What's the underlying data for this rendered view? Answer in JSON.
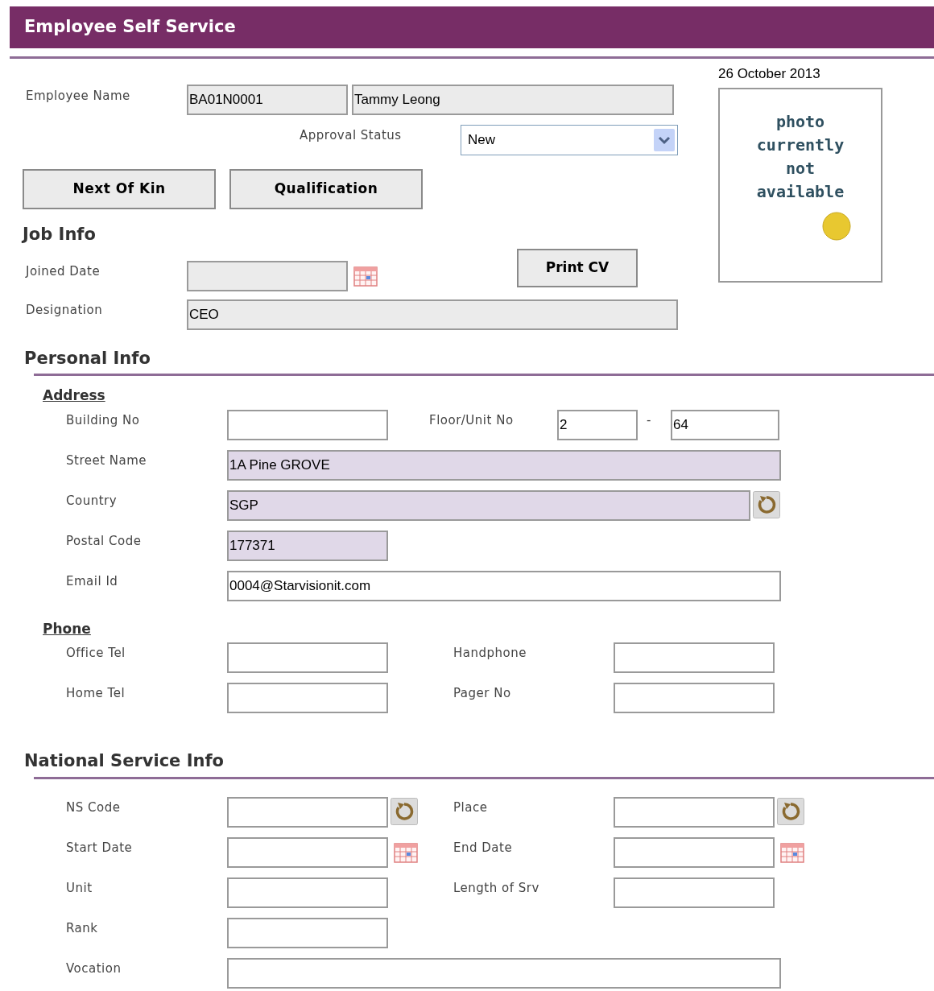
{
  "header": {
    "title": "Employee Self Service"
  },
  "date": "26 October 2013",
  "photo": {
    "text": "photo currently not available"
  },
  "employee": {
    "label": "Employee Name",
    "code": {
      "value": "BA01N0001",
      "disabled": true
    },
    "name": {
      "value": "Tammy Leong",
      "disabled": true
    }
  },
  "approval": {
    "label": "Approval Status",
    "value": "New"
  },
  "buttons": [
    "Next Of Kin",
    "Qualification"
  ],
  "job_info": {
    "title": "Job Info",
    "joined_date": {
      "label": "Joined Date",
      "disabled": true
    },
    "print_button": "Print CV",
    "designation": {
      "label": "Designation",
      "value": "CEO",
      "disabled": true
    }
  },
  "personal_info": {
    "title": "Personal Info",
    "address": {
      "title": "Address",
      "building_no": {
        "label": "Building No"
      },
      "floor_unit": {
        "label": "Floor/Unit No",
        "floor": "2",
        "separator": "-",
        "unit": "64"
      },
      "street_name": {
        "label": "Street Name",
        "value": "1A Pine GROVE",
        "mandatory": true
      },
      "country": {
        "label": "Country",
        "value": "SGP",
        "mandatory": true
      },
      "postal_code": {
        "label": "Postal Code",
        "value": "177371",
        "mandatory": true
      },
      "email": {
        "label": "Email Id",
        "value": "0004@Starvisionit.com"
      }
    },
    "phone": {
      "title": "Phone",
      "rows": [
        [
          {
            "label": "Office Tel"
          },
          {
            "label": "Handphone"
          }
        ],
        [
          {
            "label": "Home Tel"
          },
          {
            "label": "Pager No"
          }
        ]
      ]
    }
  },
  "national_service": {
    "title": "National Service Info",
    "rows": [
      [
        {
          "label": "NS Code",
          "kind": "lookup"
        },
        {
          "label": "Place",
          "kind": "lookup"
        }
      ],
      [
        {
          "label": "Start Date",
          "kind": "date"
        },
        {
          "label": "End Date",
          "kind": "date"
        }
      ],
      [
        {
          "label": "Unit",
          "kind": "text"
        },
        {
          "label": "Length of Srv",
          "kind": "text"
        }
      ],
      [
        {
          "label": "Rank",
          "kind": "text"
        }
      ]
    ],
    "vocation": {
      "label": "Vocation"
    }
  }
}
